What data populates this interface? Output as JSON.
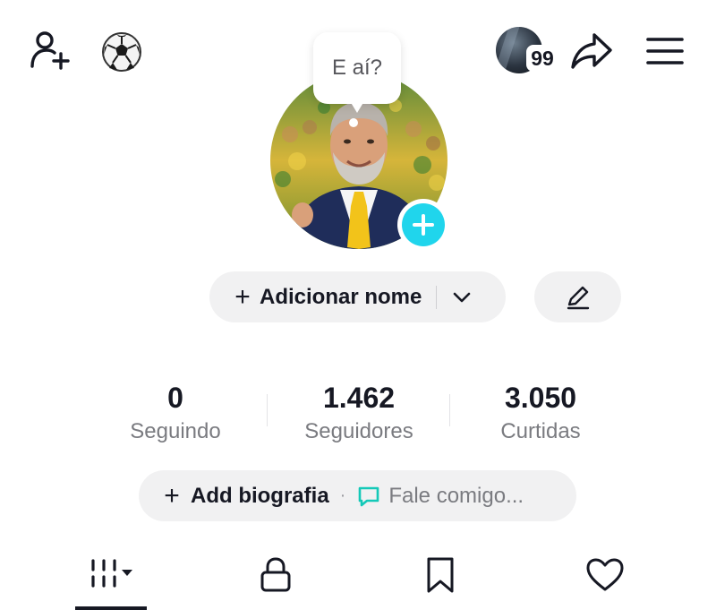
{
  "header": {
    "add_friend_icon": "person-add-icon",
    "emoji_icon": "soccer-ball-icon",
    "notification_count": "99",
    "share_icon": "share-arrow-icon",
    "menu_icon": "hamburger-menu-icon"
  },
  "bubble": {
    "text": "E aí?"
  },
  "profile": {
    "photo_icon": "profile-photo",
    "add_photo_icon": "plus-icon",
    "add_name_plus": "+",
    "add_name_label": "Adicionar nome",
    "edit_icon": "pencil-icon"
  },
  "stats": [
    {
      "value": "0",
      "label": "Seguindo"
    },
    {
      "value": "1.462",
      "label": "Seguidores"
    },
    {
      "value": "3.050",
      "label": "Curtidas"
    }
  ],
  "bio": {
    "plus": "+",
    "add_label": "Add biografia",
    "separator": "·",
    "chat_label": "Fale comigo..."
  },
  "tabs": [
    {
      "icon": "videos-grid-icon",
      "selected": true
    },
    {
      "icon": "lock-icon",
      "selected": false
    },
    {
      "icon": "bookmark-icon",
      "selected": false
    },
    {
      "icon": "heart-icon",
      "selected": false
    }
  ],
  "colors": {
    "accent": "#20d5ec",
    "chat_accent": "#14c9b8",
    "pill_bg": "#f1f1f2",
    "text": "#161823",
    "muted": "#7a7b80"
  }
}
